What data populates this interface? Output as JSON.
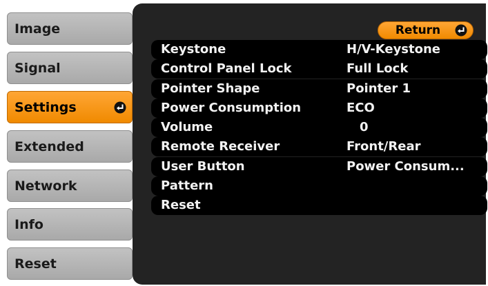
{
  "sidebar": {
    "items": [
      {
        "label": "Image"
      },
      {
        "label": "Signal"
      },
      {
        "label": "Settings"
      },
      {
        "label": "Extended"
      },
      {
        "label": "Network"
      },
      {
        "label": "Info"
      },
      {
        "label": "Reset"
      }
    ],
    "active_index": 2
  },
  "return_button": {
    "label": "Return"
  },
  "menu": {
    "rows": [
      {
        "label": "Keystone",
        "value": "H/V-Keystone"
      },
      {
        "label": "Control Panel Lock",
        "value": "Full Lock"
      },
      {
        "label": "Pointer Shape",
        "value": "Pointer 1"
      },
      {
        "label": "Power Consumption",
        "value": "ECO"
      },
      {
        "label": "Volume",
        "value": "0"
      },
      {
        "label": "Remote Receiver",
        "value": "Front/Rear"
      },
      {
        "label": "User Button",
        "value": "Power Consum..."
      },
      {
        "label": "Pattern",
        "value": ""
      },
      {
        "label": "Reset",
        "value": ""
      }
    ]
  },
  "colors": {
    "accent": "#f59a16",
    "panel": "#232323",
    "row": "#000000",
    "tab": "#b8b8b8"
  },
  "icons": {
    "enter": "enter-arrow-icon"
  }
}
